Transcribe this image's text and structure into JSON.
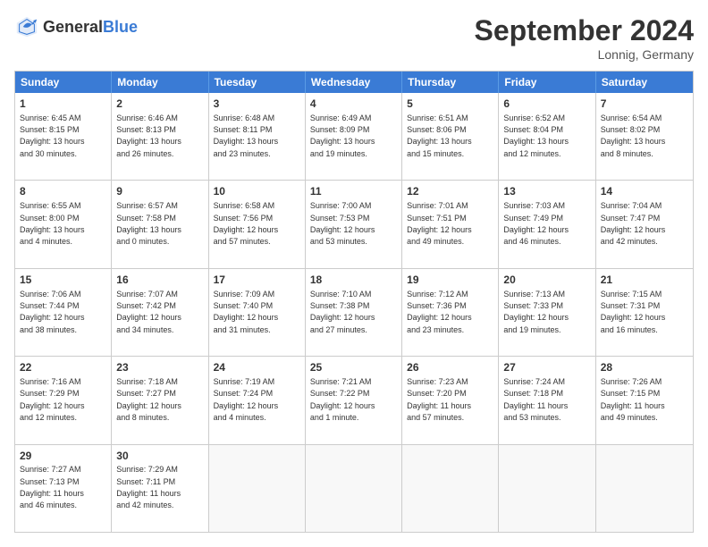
{
  "header": {
    "logo_general": "General",
    "logo_blue": "Blue",
    "month_year": "September 2024",
    "location": "Lonnig, Germany"
  },
  "calendar": {
    "days_of_week": [
      "Sunday",
      "Monday",
      "Tuesday",
      "Wednesday",
      "Thursday",
      "Friday",
      "Saturday"
    ],
    "rows": [
      [
        {
          "day": "",
          "empty": true,
          "lines": []
        },
        {
          "day": "2",
          "empty": false,
          "lines": [
            "Sunrise: 6:46 AM",
            "Sunset: 8:13 PM",
            "Daylight: 13 hours",
            "and 26 minutes."
          ]
        },
        {
          "day": "3",
          "empty": false,
          "lines": [
            "Sunrise: 6:48 AM",
            "Sunset: 8:11 PM",
            "Daylight: 13 hours",
            "and 23 minutes."
          ]
        },
        {
          "day": "4",
          "empty": false,
          "lines": [
            "Sunrise: 6:49 AM",
            "Sunset: 8:09 PM",
            "Daylight: 13 hours",
            "and 19 minutes."
          ]
        },
        {
          "day": "5",
          "empty": false,
          "lines": [
            "Sunrise: 6:51 AM",
            "Sunset: 8:06 PM",
            "Daylight: 13 hours",
            "and 15 minutes."
          ]
        },
        {
          "day": "6",
          "empty": false,
          "lines": [
            "Sunrise: 6:52 AM",
            "Sunset: 8:04 PM",
            "Daylight: 13 hours",
            "and 12 minutes."
          ]
        },
        {
          "day": "7",
          "empty": false,
          "lines": [
            "Sunrise: 6:54 AM",
            "Sunset: 8:02 PM",
            "Daylight: 13 hours",
            "and 8 minutes."
          ]
        }
      ],
      [
        {
          "day": "8",
          "empty": false,
          "lines": [
            "Sunrise: 6:55 AM",
            "Sunset: 8:00 PM",
            "Daylight: 13 hours",
            "and 4 minutes."
          ]
        },
        {
          "day": "9",
          "empty": false,
          "lines": [
            "Sunrise: 6:57 AM",
            "Sunset: 7:58 PM",
            "Daylight: 13 hours",
            "and 0 minutes."
          ]
        },
        {
          "day": "10",
          "empty": false,
          "lines": [
            "Sunrise: 6:58 AM",
            "Sunset: 7:56 PM",
            "Daylight: 12 hours",
            "and 57 minutes."
          ]
        },
        {
          "day": "11",
          "empty": false,
          "lines": [
            "Sunrise: 7:00 AM",
            "Sunset: 7:53 PM",
            "Daylight: 12 hours",
            "and 53 minutes."
          ]
        },
        {
          "day": "12",
          "empty": false,
          "lines": [
            "Sunrise: 7:01 AM",
            "Sunset: 7:51 PM",
            "Daylight: 12 hours",
            "and 49 minutes."
          ]
        },
        {
          "day": "13",
          "empty": false,
          "lines": [
            "Sunrise: 7:03 AM",
            "Sunset: 7:49 PM",
            "Daylight: 12 hours",
            "and 46 minutes."
          ]
        },
        {
          "day": "14",
          "empty": false,
          "lines": [
            "Sunrise: 7:04 AM",
            "Sunset: 7:47 PM",
            "Daylight: 12 hours",
            "and 42 minutes."
          ]
        }
      ],
      [
        {
          "day": "15",
          "empty": false,
          "lines": [
            "Sunrise: 7:06 AM",
            "Sunset: 7:44 PM",
            "Daylight: 12 hours",
            "and 38 minutes."
          ]
        },
        {
          "day": "16",
          "empty": false,
          "lines": [
            "Sunrise: 7:07 AM",
            "Sunset: 7:42 PM",
            "Daylight: 12 hours",
            "and 34 minutes."
          ]
        },
        {
          "day": "17",
          "empty": false,
          "lines": [
            "Sunrise: 7:09 AM",
            "Sunset: 7:40 PM",
            "Daylight: 12 hours",
            "and 31 minutes."
          ]
        },
        {
          "day": "18",
          "empty": false,
          "lines": [
            "Sunrise: 7:10 AM",
            "Sunset: 7:38 PM",
            "Daylight: 12 hours",
            "and 27 minutes."
          ]
        },
        {
          "day": "19",
          "empty": false,
          "lines": [
            "Sunrise: 7:12 AM",
            "Sunset: 7:36 PM",
            "Daylight: 12 hours",
            "and 23 minutes."
          ]
        },
        {
          "day": "20",
          "empty": false,
          "lines": [
            "Sunrise: 7:13 AM",
            "Sunset: 7:33 PM",
            "Daylight: 12 hours",
            "and 19 minutes."
          ]
        },
        {
          "day": "21",
          "empty": false,
          "lines": [
            "Sunrise: 7:15 AM",
            "Sunset: 7:31 PM",
            "Daylight: 12 hours",
            "and 16 minutes."
          ]
        }
      ],
      [
        {
          "day": "22",
          "empty": false,
          "lines": [
            "Sunrise: 7:16 AM",
            "Sunset: 7:29 PM",
            "Daylight: 12 hours",
            "and 12 minutes."
          ]
        },
        {
          "day": "23",
          "empty": false,
          "lines": [
            "Sunrise: 7:18 AM",
            "Sunset: 7:27 PM",
            "Daylight: 12 hours",
            "and 8 minutes."
          ]
        },
        {
          "day": "24",
          "empty": false,
          "lines": [
            "Sunrise: 7:19 AM",
            "Sunset: 7:24 PM",
            "Daylight: 12 hours",
            "and 4 minutes."
          ]
        },
        {
          "day": "25",
          "empty": false,
          "lines": [
            "Sunrise: 7:21 AM",
            "Sunset: 7:22 PM",
            "Daylight: 12 hours",
            "and 1 minute."
          ]
        },
        {
          "day": "26",
          "empty": false,
          "lines": [
            "Sunrise: 7:23 AM",
            "Sunset: 7:20 PM",
            "Daylight: 11 hours",
            "and 57 minutes."
          ]
        },
        {
          "day": "27",
          "empty": false,
          "lines": [
            "Sunrise: 7:24 AM",
            "Sunset: 7:18 PM",
            "Daylight: 11 hours",
            "and 53 minutes."
          ]
        },
        {
          "day": "28",
          "empty": false,
          "lines": [
            "Sunrise: 7:26 AM",
            "Sunset: 7:15 PM",
            "Daylight: 11 hours",
            "and 49 minutes."
          ]
        }
      ],
      [
        {
          "day": "29",
          "empty": false,
          "lines": [
            "Sunrise: 7:27 AM",
            "Sunset: 7:13 PM",
            "Daylight: 11 hours",
            "and 46 minutes."
          ]
        },
        {
          "day": "30",
          "empty": false,
          "lines": [
            "Sunrise: 7:29 AM",
            "Sunset: 7:11 PM",
            "Daylight: 11 hours",
            "and 42 minutes."
          ]
        },
        {
          "day": "",
          "empty": true,
          "lines": []
        },
        {
          "day": "",
          "empty": true,
          "lines": []
        },
        {
          "day": "",
          "empty": true,
          "lines": []
        },
        {
          "day": "",
          "empty": true,
          "lines": []
        },
        {
          "day": "",
          "empty": true,
          "lines": []
        }
      ]
    ],
    "first_row_sunday": {
      "day": "1",
      "lines": [
        "Sunrise: 6:45 AM",
        "Sunset: 8:15 PM",
        "Daylight: 13 hours",
        "and 30 minutes."
      ]
    }
  }
}
